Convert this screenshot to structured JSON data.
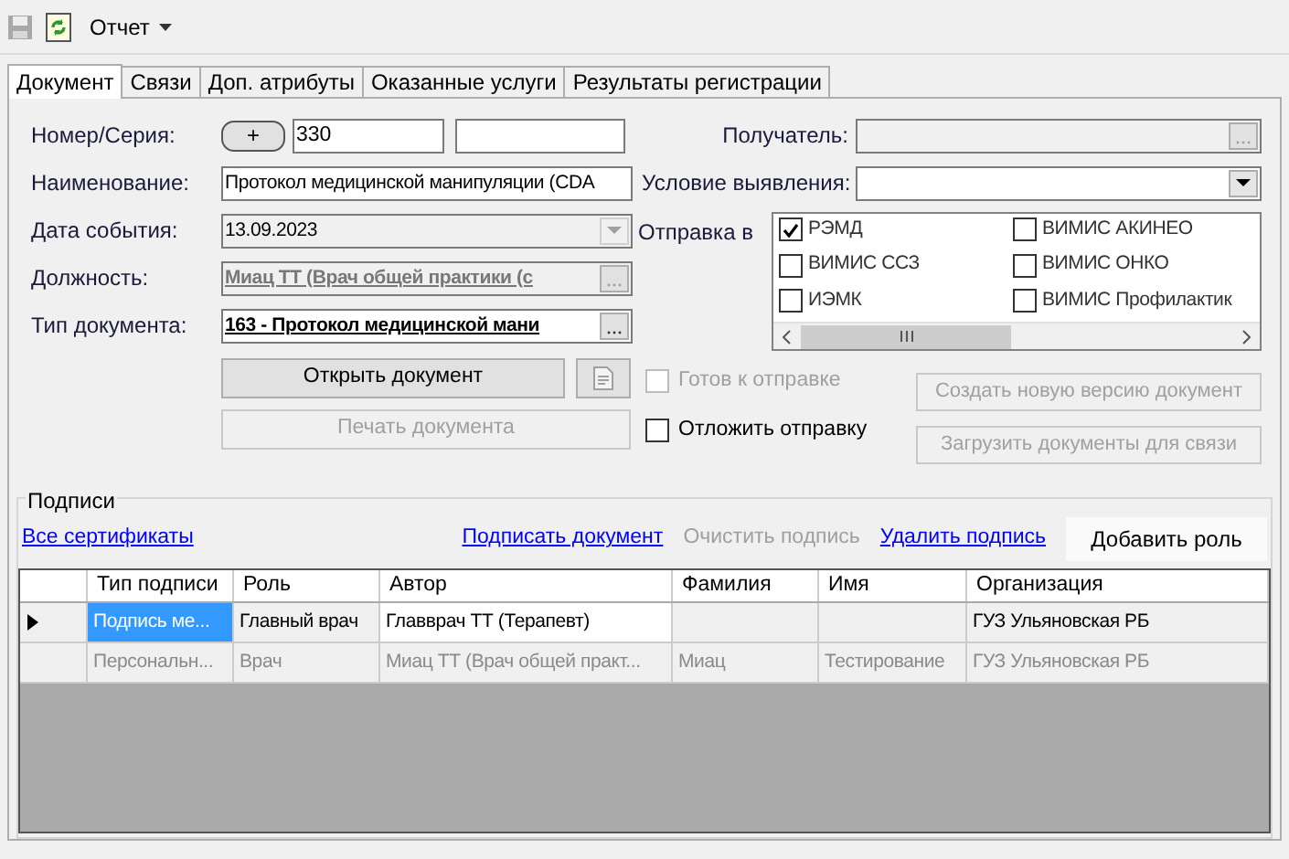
{
  "toolbar": {
    "report_menu": "Отчет",
    "save_disabled": true
  },
  "tabs": [
    {
      "label": "Документ",
      "selected": true
    },
    {
      "label": "Связи",
      "selected": false
    },
    {
      "label": "Доп. атрибуты",
      "selected": false
    },
    {
      "label": "Оказанные услуги",
      "selected": false
    },
    {
      "label": "Результаты регистрации",
      "selected": false
    }
  ],
  "number_row": {
    "label": "Номер/Серия:",
    "add_button": "+",
    "number": "330"
  },
  "left_fields": [
    {
      "label": "Наименование:",
      "kind": "text",
      "value": "Протокол медицинской манипуляции (CDA",
      "disabled": false,
      "bold": false
    },
    {
      "label": "Дата события:",
      "kind": "combo",
      "value": "13.09.2023",
      "disabled": true,
      "bold": false
    },
    {
      "label": "Должность:",
      "kind": "lookup",
      "value": "Миац ТТ (Врач общей практики (с",
      "disabled": true,
      "bold": true
    },
    {
      "label": "Тип документа:",
      "kind": "lookup",
      "value": "163 - Протокол медицинской мани",
      "disabled": false,
      "bold": true
    }
  ],
  "open_button": {
    "label": "Открыть документ"
  },
  "print_button": {
    "label": "Печать документа",
    "disabled": true
  },
  "right_fields": [
    {
      "label": "Получатель:",
      "kind": "lookup",
      "disabled": true
    },
    {
      "label": "Условие выявления:",
      "kind": "combo",
      "disabled": false
    }
  ],
  "send_to": {
    "label": "Отправка в",
    "items": [
      {
        "label": "РЭМД",
        "checked": true
      },
      {
        "label": "ВИМИС АКИНЕО",
        "checked": false
      },
      {
        "label": "ВИМИС ССЗ",
        "checked": false
      },
      {
        "label": "ВИМИС ОНКО",
        "checked": false
      },
      {
        "label": "ИЭМК",
        "checked": false
      },
      {
        "label": "ВИМИС Профилактик",
        "checked": false
      }
    ]
  },
  "options": [
    {
      "label": "Готов к отправке",
      "checked": false,
      "disabled": true
    },
    {
      "label": "Отложить отправку",
      "checked": false,
      "disabled": false
    }
  ],
  "side_buttons": [
    {
      "label": "Создать новую версию документ",
      "disabled": true
    },
    {
      "label": "Загрузить документы для связи",
      "disabled": true
    }
  ],
  "signatures": {
    "title": "Подписи",
    "all_certs_link": "Все сертификаты",
    "links": [
      {
        "label": "Подписать документ",
        "disabled": false
      },
      {
        "label": "Очистить подпись",
        "disabled": true
      },
      {
        "label": "Удалить подпись",
        "disabled": false
      }
    ],
    "add_role_button": "Добавить роль",
    "columns": [
      "Тип подписи",
      "Роль",
      "Автор",
      "Фамилия",
      "Имя",
      "Организация"
    ],
    "rows": [
      {
        "current": true,
        "disabled": false,
        "cells": [
          {
            "text": "Подпись ме...",
            "selected": true
          },
          {
            "text": "Главный врач",
            "selected": false
          },
          {
            "text": "Главврач ТТ (Терапевт)",
            "selected": false
          },
          {
            "text": "",
            "selected": false
          },
          {
            "text": "",
            "selected": false
          },
          {
            "text": "ГУЗ Ульяновская РБ",
            "selected": false
          }
        ]
      },
      {
        "current": false,
        "disabled": true,
        "cells": [
          {
            "text": "Персональн...",
            "selected": false
          },
          {
            "text": "Врач",
            "selected": false
          },
          {
            "text": "Миац ТТ (Врач общей практ...",
            "selected": false
          },
          {
            "text": "Миац",
            "selected": false
          },
          {
            "text": "Тестирование",
            "selected": false
          },
          {
            "text": "ГУЗ Ульяновская РБ",
            "selected": false
          }
        ]
      }
    ]
  }
}
